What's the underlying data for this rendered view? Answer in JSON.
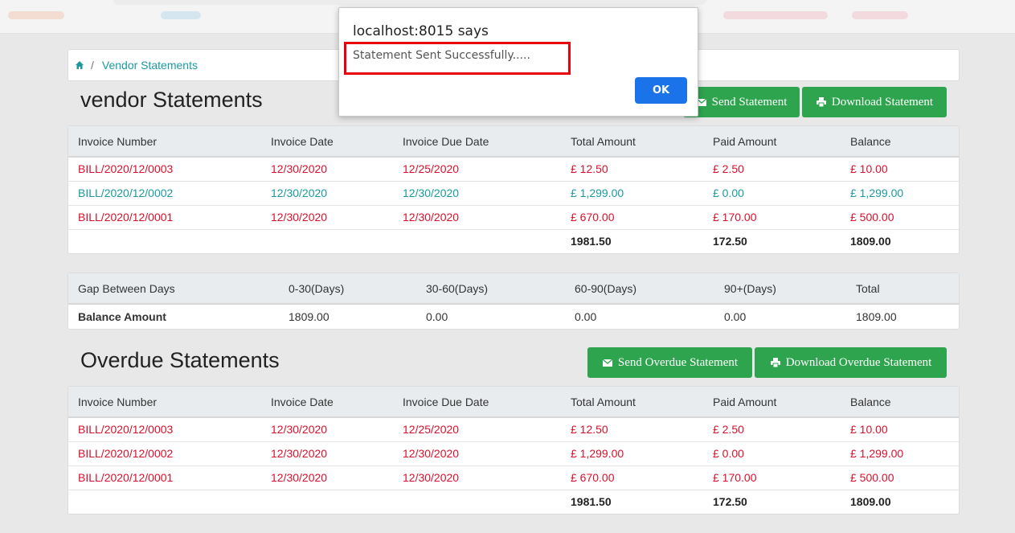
{
  "breadcrumb": {
    "current": "Vendor Statements"
  },
  "vendor": {
    "title": "vendor Statements",
    "send_label": "Send Statement",
    "download_label": "Download Statement"
  },
  "columns": [
    "Invoice Number",
    "Invoice Date",
    "Invoice Due Date",
    "Total Amount",
    "Paid Amount",
    "Balance"
  ],
  "vendor_rows": [
    {
      "status": "red",
      "cells": [
        "BILL/2020/12/0003",
        "12/30/2020",
        "12/25/2020",
        "£ 12.50",
        "£ 2.50",
        "£ 10.00"
      ]
    },
    {
      "status": "teal",
      "cells": [
        "BILL/2020/12/0002",
        "12/30/2020",
        "12/30/2020",
        "£ 1,299.00",
        "£ 0.00",
        "£ 1,299.00"
      ]
    },
    {
      "status": "red",
      "cells": [
        "BILL/2020/12/0001",
        "12/30/2020",
        "12/30/2020",
        "£ 670.00",
        "£ 170.00",
        "£ 500.00"
      ]
    }
  ],
  "vendor_totals": {
    "total": "1981.50",
    "paid": "172.50",
    "balance": "1809.00"
  },
  "aging": {
    "headers": [
      "Gap Between Days",
      "0-30(Days)",
      "30-60(Days)",
      "60-90(Days)",
      "90+(Days)",
      "Total"
    ],
    "row": [
      "Balance Amount",
      "1809.00",
      "0.00",
      "0.00",
      "0.00",
      "1809.00"
    ]
  },
  "overdue": {
    "title": "Overdue Statements",
    "send_label": "Send Overdue Statement",
    "download_label": "Download Overdue Statement"
  },
  "overdue_rows": [
    {
      "status": "red",
      "cells": [
        "BILL/2020/12/0003",
        "12/30/2020",
        "12/25/2020",
        "£ 12.50",
        "£ 2.50",
        "£ 10.00"
      ]
    },
    {
      "status": "red",
      "cells": [
        "BILL/2020/12/0002",
        "12/30/2020",
        "12/30/2020",
        "£ 1,299.00",
        "£ 0.00",
        "£ 1,299.00"
      ]
    },
    {
      "status": "red",
      "cells": [
        "BILL/2020/12/0001",
        "12/30/2020",
        "12/30/2020",
        "£ 670.00",
        "£ 170.00",
        "£ 500.00"
      ]
    }
  ],
  "overdue_totals": {
    "total": "1981.50",
    "paid": "172.50",
    "balance": "1809.00"
  },
  "dialog": {
    "title": "localhost:8015 says",
    "message": "Statement Sent Successfully.....",
    "ok_label": "OK"
  },
  "colors": {
    "red": "#d9102b",
    "teal": "#1a9aa0",
    "green": "#2ea44f",
    "ok_blue": "#1a73e8",
    "highlight": "#e8000f"
  }
}
